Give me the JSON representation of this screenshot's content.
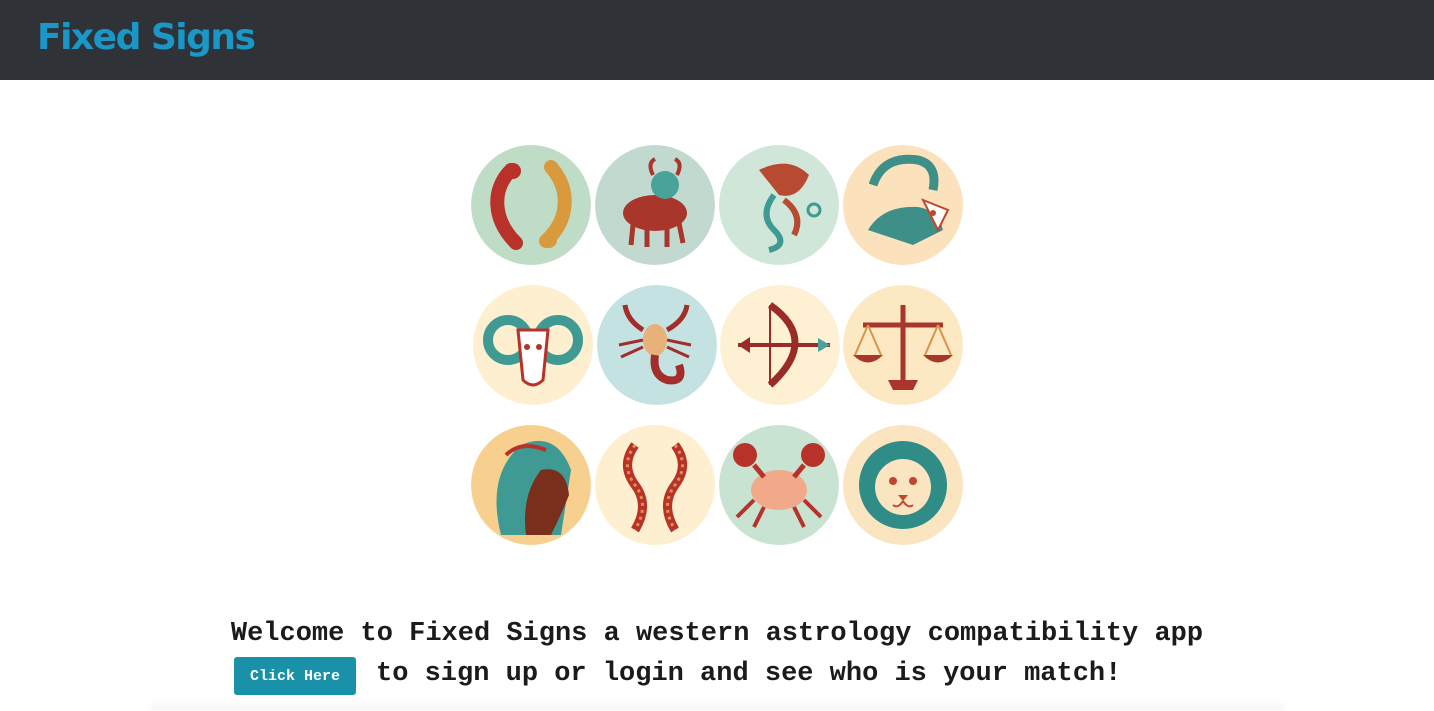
{
  "navbar": {
    "brand": "Fixed Signs",
    "background": "#2f3337",
    "brand_color": "#1a97c9"
  },
  "signs": [
    {
      "name": "pisces",
      "bg": "#bfdcc6",
      "main": "#b8322a",
      "accent": "#d99a3e"
    },
    {
      "name": "taurus",
      "bg": "#c2d9cf",
      "main": "#a8362b",
      "accent": "#4aa39a"
    },
    {
      "name": "aquarius",
      "bg": "#cfe6d8",
      "main": "#b84a32",
      "accent": "#3f9a94"
    },
    {
      "name": "capricorn",
      "bg": "#fbe2bc",
      "main": "#3f8f89",
      "accent": "#c0462f"
    },
    {
      "name": "aries",
      "bg": "#fdefcf",
      "main": "#3f9a94",
      "accent": "#b8322a"
    },
    {
      "name": "scorpio",
      "bg": "#c5e2e2",
      "main": "#a32d2a",
      "accent": "#e7b27a"
    },
    {
      "name": "sagittarius",
      "bg": "#fdf0d3",
      "main": "#9a2c28",
      "accent": "#4aa39a"
    },
    {
      "name": "libra",
      "bg": "#fde8c4",
      "main": "#a8362b",
      "accent": "#d9934a"
    },
    {
      "name": "virgo",
      "bg": "#f7cf8f",
      "main": "#7a2e1c",
      "accent": "#3f9a94"
    },
    {
      "name": "gemini",
      "bg": "#fdefcf",
      "main": "#b8322a",
      "accent": "#d9934a"
    },
    {
      "name": "cancer",
      "bg": "#c8e3d2",
      "main": "#b8322a",
      "accent": "#f2a98a"
    },
    {
      "name": "leo",
      "bg": "#fbe4c0",
      "main": "#2f8c87",
      "accent": "#c0462f"
    }
  ],
  "main": {
    "welcome_text": "Welcome to Fixed Signs a western astrology compatibility app",
    "cta_button": "Click Here",
    "cta_suffix": "to sign up or login and see who is your match!",
    "cta_color": "#1891a9"
  }
}
